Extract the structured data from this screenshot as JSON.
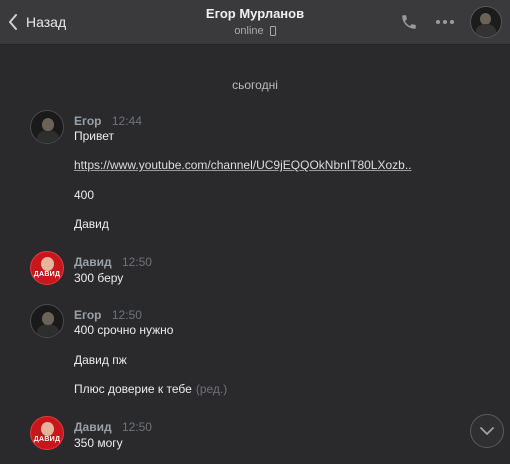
{
  "header": {
    "back_label": "Назад",
    "title": "Егор Мурланов",
    "status": "online"
  },
  "chat": {
    "date_separator": "сьогодні",
    "messages": [
      {
        "author": "Егор",
        "time": "12:44",
        "lines": [
          "Привет",
          "https://www.youtube.com/channel/UC9jEQQOkNbnIT80LXozb..",
          "400",
          "Давид"
        ]
      },
      {
        "author": "Давид",
        "time": "12:50",
        "avatar_text": "ДАВИД",
        "lines": [
          "300 беру"
        ]
      },
      {
        "author": "Егор",
        "time": "12:50",
        "lines": [
          "400 срочно нужно",
          "Давид пж",
          "Плюс доверие к тебе"
        ],
        "edited_label": "(ред.)"
      },
      {
        "author": "Давид",
        "time": "12:50",
        "avatar_text": "ДАВИД",
        "lines": [
          "350 могу"
        ]
      }
    ]
  },
  "colors": {
    "background": "#2a2a2d",
    "header": "#3a3a3d",
    "david_avatar": "#c8161d"
  },
  "icons": {
    "back": "chevron-left-icon",
    "call": "phone-icon",
    "more": "more-dots-icon",
    "status_device": "mobile-device-icon",
    "scroll": "chevron-down-icon"
  }
}
